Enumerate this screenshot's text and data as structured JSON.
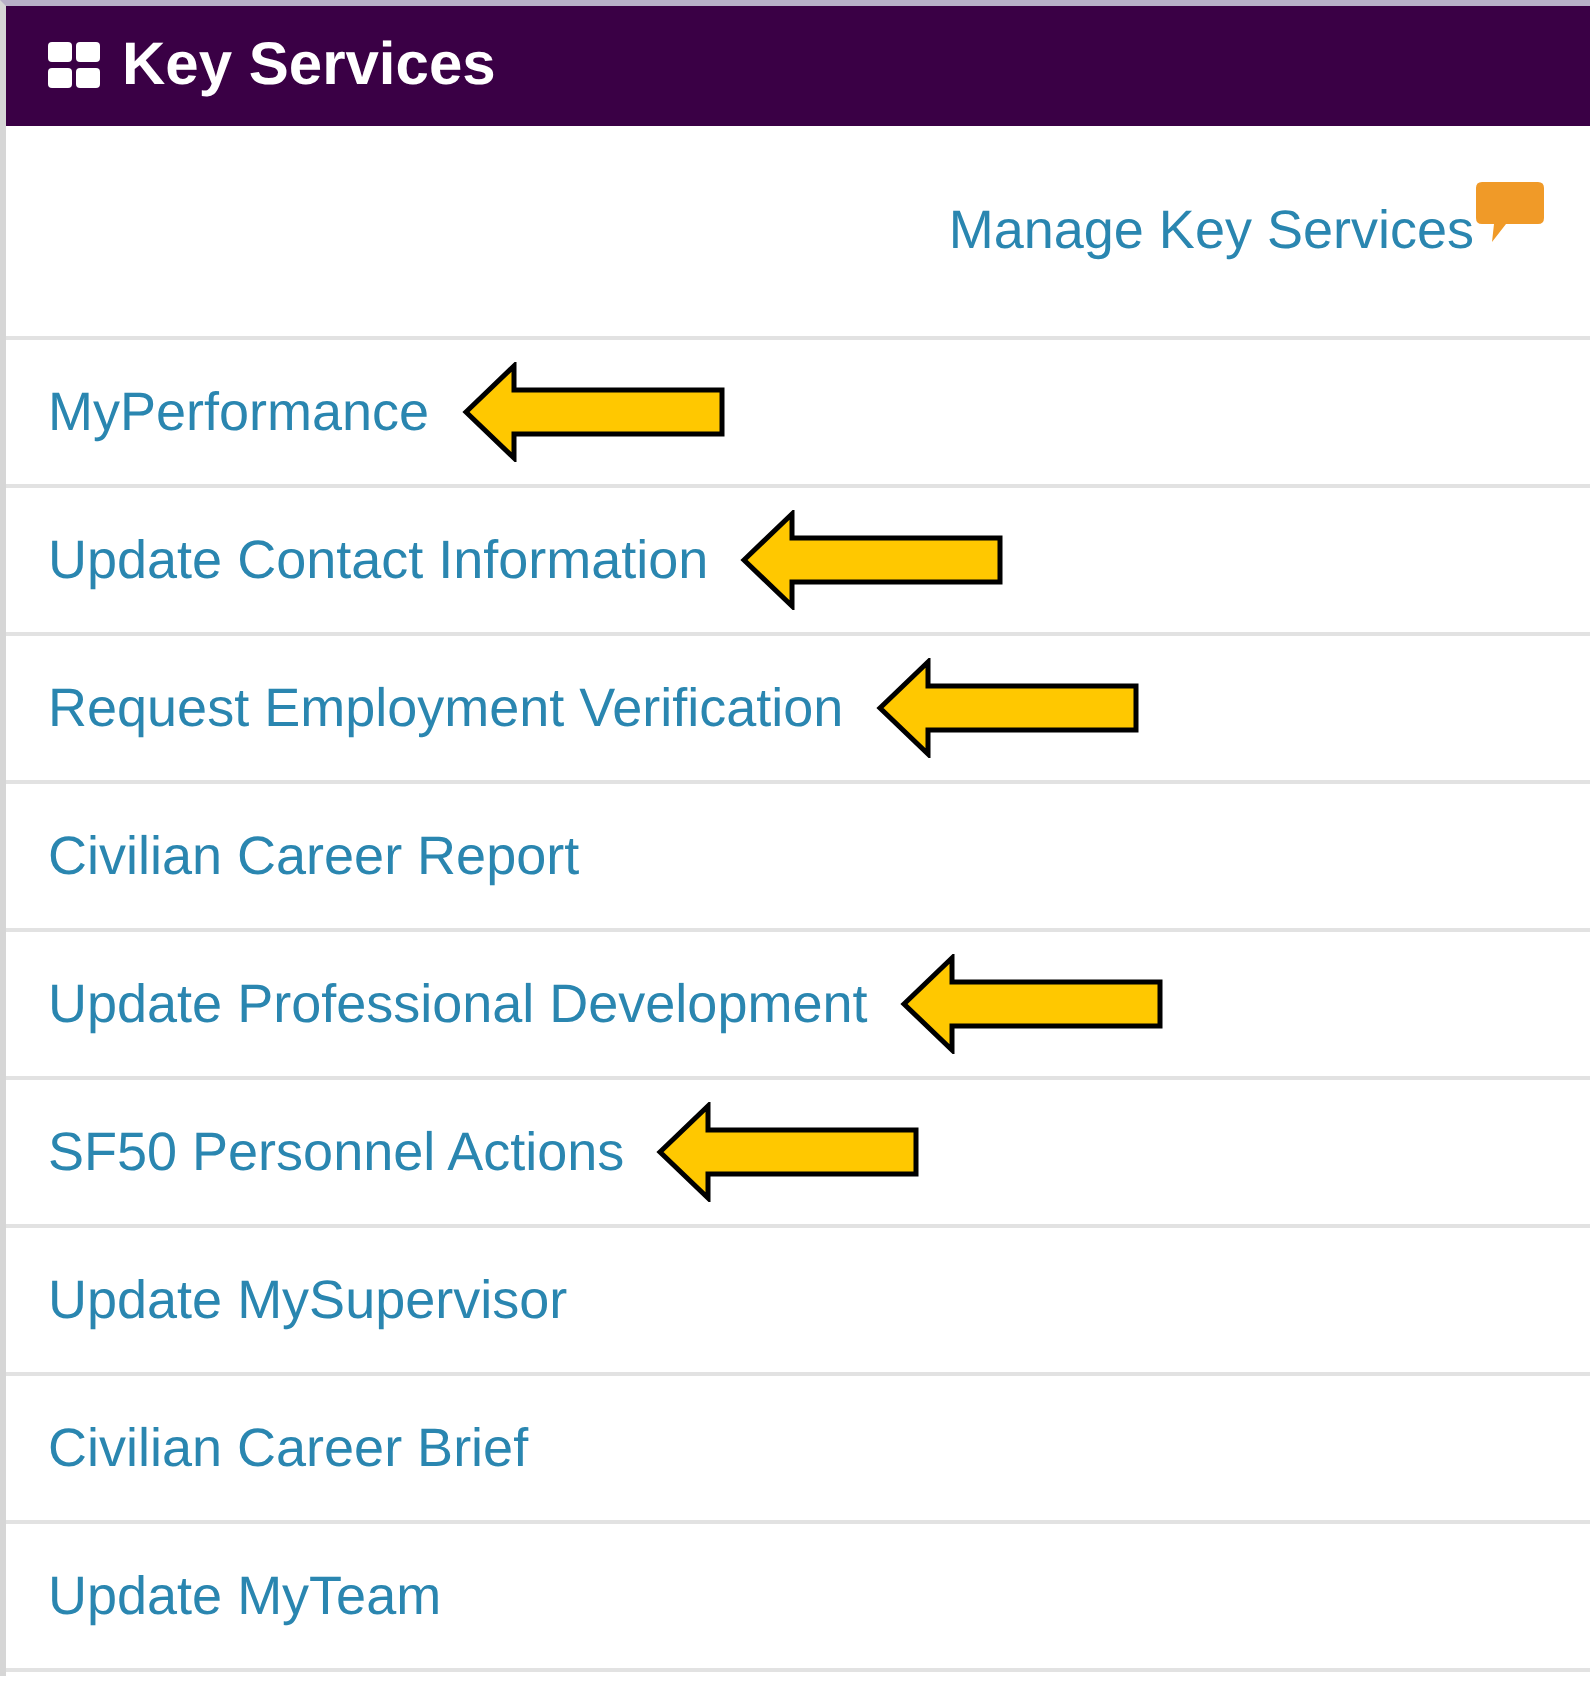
{
  "panel": {
    "title": "Key Services"
  },
  "manage_link": {
    "label": "Manage Key Services"
  },
  "services": [
    {
      "label": "MyPerformance",
      "arrow": true
    },
    {
      "label": "Update Contact Information",
      "arrow": true
    },
    {
      "label": "Request Employment Verification",
      "arrow": true
    },
    {
      "label": "Civilian Career Report",
      "arrow": false
    },
    {
      "label": "Update Professional Development",
      "arrow": true
    },
    {
      "label": "SF50 Personnel Actions",
      "arrow": true
    },
    {
      "label": "Update MySupervisor",
      "arrow": false
    },
    {
      "label": "Civilian Career Brief",
      "arrow": false
    },
    {
      "label": "Update MyTeam",
      "arrow": false
    }
  ]
}
